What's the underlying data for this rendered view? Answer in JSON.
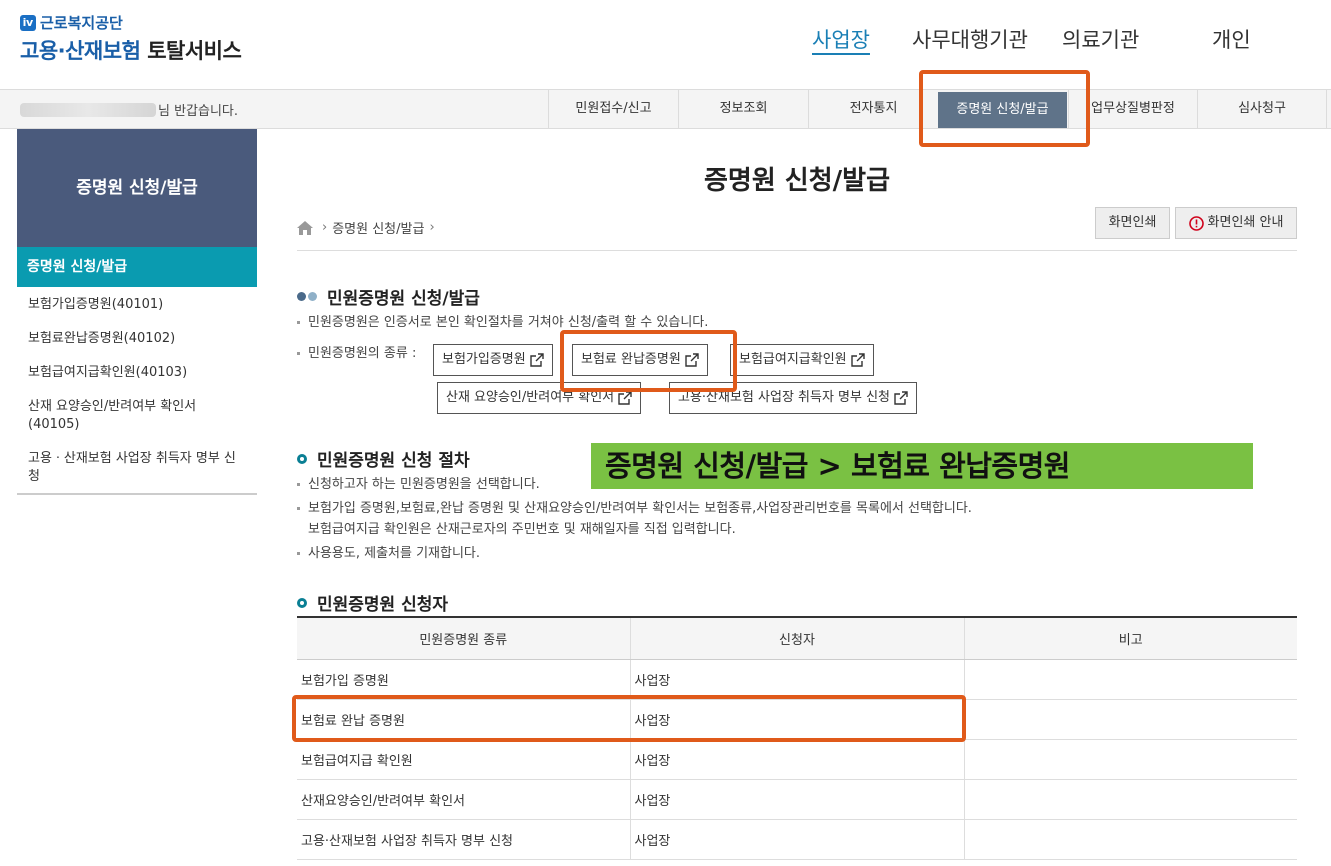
{
  "header": {
    "org_name": "근로복지공단",
    "service_name_blue": "고용·산재보험",
    "service_name_dark": "토탈서비스",
    "nav": [
      "사업장",
      "사무대행기관",
      "의료기관",
      "개인"
    ],
    "active_nav": "사업장"
  },
  "graybar": {
    "welcome_suffix": "님 반갑습니다.",
    "tabs": [
      "민원접수/신고",
      "정보조회",
      "전자통지",
      "증명원 신청/발급",
      "업무상질병판정",
      "심사청구"
    ],
    "active_tab": "증명원 신청/발급"
  },
  "sidebar": {
    "title": "증명원 신청/발급",
    "active_item": "증명원 신청/발급",
    "items": [
      "보험가입증명원(40101)",
      "보험료완납증명원(40102)",
      "보험급여지급확인원(40103)",
      "산재 요양승인/반려여부 확인서 (40105)",
      "고용ㆍ산재보험 사업장 취득자 명부 신청"
    ]
  },
  "main": {
    "title": "증명원 신청/발급",
    "breadcrumb": [
      "증명원 신청/발급"
    ],
    "print_button": "화면인쇄",
    "print_guide_button": "화면인쇄 안내",
    "section1": {
      "heading": "민원증명원 신청/발급",
      "bullet1": "민원증명원은 인증서로 본인 확인절차를 거쳐야 신청/출력 할 수 있습니다.",
      "kinds_label": "민원증명원의 종류 :",
      "cert_buttons": [
        "보험가입증명원",
        "보험료 완납증명원",
        "보험급여지급확인원",
        "산재 요양승인/반려여부 확인서",
        "고용·산재보험 사업장 취득자 명부 신청"
      ]
    },
    "section2": {
      "heading": "민원증명원 신청 절차",
      "bullets": [
        "신청하고자 하는 민원증명원을 선택합니다.",
        "보험가입 증명원,보험료,완납 증명원 및 산재요양승인/반려여부 확인서는 보험종류,사업장관리번호를 목록에서 선택합니다.",
        "보험급여지급 확인원은 산재근로자의 주민번호 및 재해일자를 직접 입력합니다.",
        "사용용도, 제출처를 기재합니다."
      ]
    },
    "section3": {
      "heading": "민원증명원 신청자",
      "columns": [
        "민원증명원 종류",
        "신청자",
        "비고"
      ],
      "rows": [
        [
          "보험가입 증명원",
          "사업장",
          ""
        ],
        [
          "보험료 완납 증명원",
          "사업장",
          ""
        ],
        [
          "보험급여지급 확인원",
          "사업장",
          ""
        ],
        [
          "산재요양승인/반려여부 확인서",
          "사업장",
          ""
        ],
        [
          "고용·산재보험 사업장 취득자 명부 신청",
          "사업장",
          ""
        ]
      ]
    }
  },
  "annotation": {
    "banner_text": "증명원 신청/발급  > 보험료 완납증명원",
    "highlight_color": "#e05a1a",
    "banner_color": "#7ac143"
  }
}
